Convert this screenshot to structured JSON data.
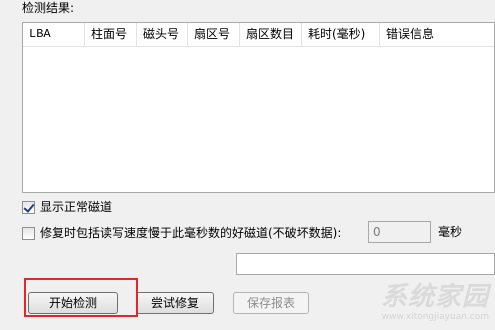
{
  "results": {
    "section_label": "检测结果:",
    "columns": [
      "LBA",
      "柱面号",
      "磁头号",
      "扇区号",
      "扇区数目",
      "耗时(毫秒)",
      "错误信息"
    ]
  },
  "options": {
    "show_normal_tracks": {
      "label": "显示正常磁道",
      "checked": true
    },
    "repair_slow_tracks": {
      "label": "修复时包括读写速度慢于此毫秒数的好磁道(不破坏数据):",
      "checked": false
    },
    "threshold_value": "0",
    "threshold_unit": "毫秒"
  },
  "status_text": "",
  "buttons": {
    "start": "开始检测",
    "repair": "尝试修复",
    "save_report": "保存报表"
  },
  "watermark": {
    "main": "系统家园",
    "sub": "www.xitongjiayuan.com"
  }
}
